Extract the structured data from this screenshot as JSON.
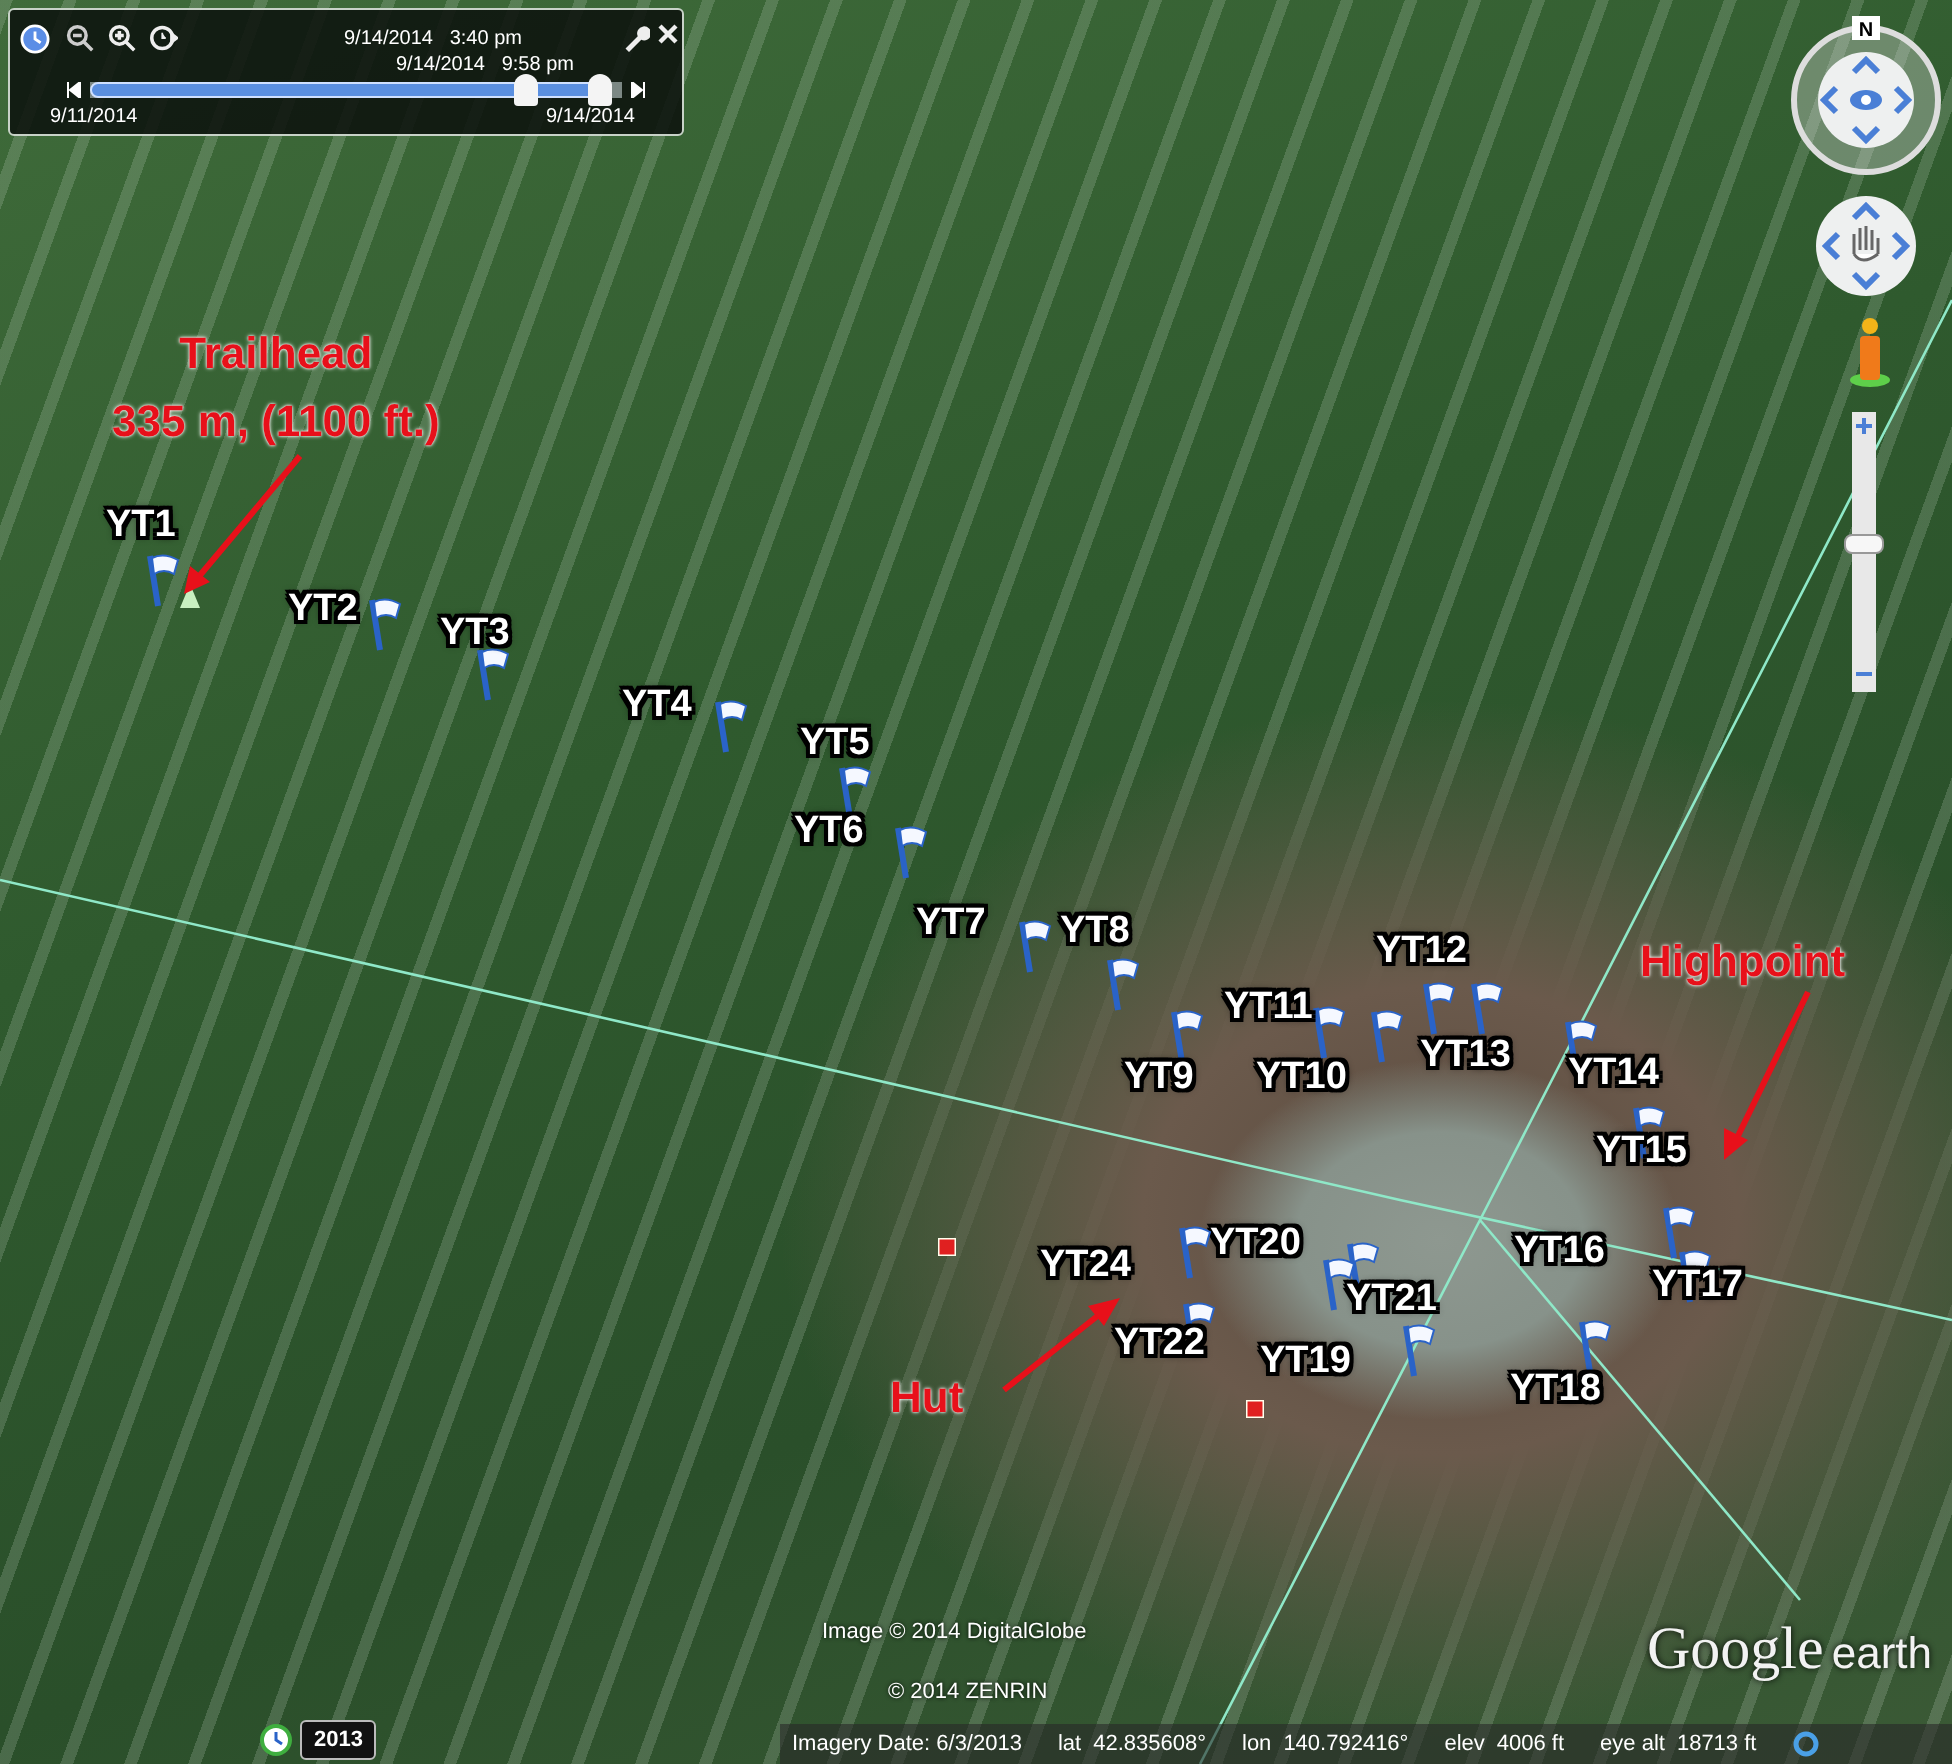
{
  "time_slider": {
    "current_time": "9/14/2014   3:40 pm",
    "window_end_time": "9/14/2014   9:58 pm",
    "start_date": "9/11/2014",
    "end_date": "9/14/2014",
    "level": 0.96
  },
  "navigation": {
    "compass_label": "N",
    "zoom_slider": {
      "level": 0.55
    }
  },
  "placemarks": [
    {
      "label": "YT1"
    },
    {
      "label": "YT2"
    },
    {
      "label": "YT3"
    },
    {
      "label": "YT4"
    },
    {
      "label": "YT5"
    },
    {
      "label": "YT6"
    },
    {
      "label": "YT7"
    },
    {
      "label": "YT8"
    },
    {
      "label": "YT9"
    },
    {
      "label": "YT10"
    },
    {
      "label": "YT11"
    },
    {
      "label": "YT12"
    },
    {
      "label": "YT13"
    },
    {
      "label": "YT14"
    },
    {
      "label": "YT15"
    },
    {
      "label": "YT16"
    },
    {
      "label": "YT17"
    },
    {
      "label": "YT18"
    },
    {
      "label": "YT19"
    },
    {
      "label": "YT20"
    },
    {
      "label": "YT21"
    },
    {
      "label": "YT22"
    },
    {
      "label": "YT24"
    }
  ],
  "annotations": [
    {
      "lines": [
        "Trailhead",
        "335 m, (1100 ft.)"
      ]
    },
    {
      "lines": [
        "Highpoint"
      ]
    },
    {
      "lines": [
        "Hut"
      ]
    }
  ],
  "credits": [
    "Image © 2014 DigitalGlobe",
    "© 2014 ZENRIN"
  ],
  "logo": {
    "brand": "Google",
    "product": "earth"
  },
  "historical_imagery": {
    "year": "2013"
  },
  "status_bar": {
    "imagery_date": "Imagery Date: 6/3/2013",
    "fields": [
      {
        "label": "lat",
        "value": "42.835608°"
      },
      {
        "label": "lon",
        "value": "140.792416°"
      },
      {
        "label": "elev",
        "value": "4006 ft"
      },
      {
        "label": "eye alt",
        "value": "18713 ft"
      }
    ]
  }
}
